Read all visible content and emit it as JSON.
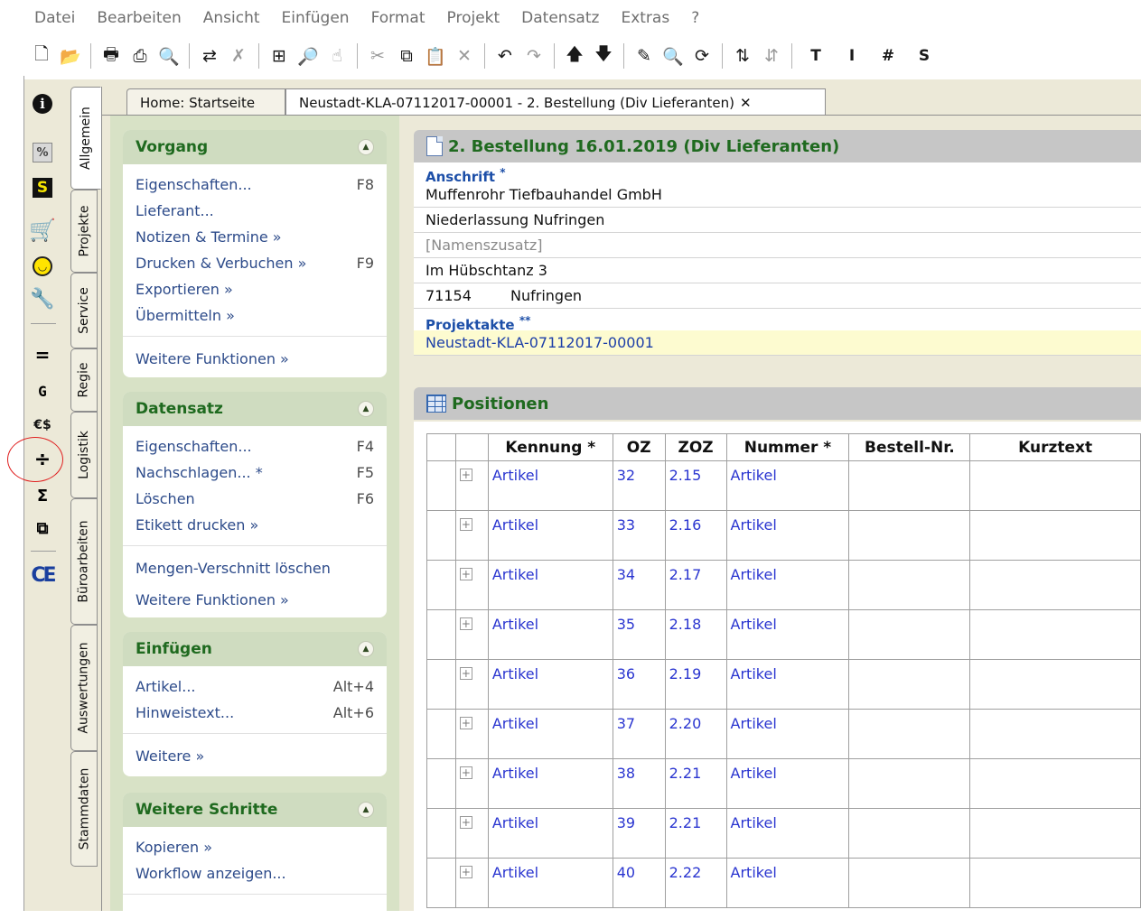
{
  "menu": [
    "Datei",
    "Bearbeiten",
    "Ansicht",
    "Einfügen",
    "Format",
    "Projekt",
    "Datensatz",
    "Extras",
    "?"
  ],
  "toolbar_text": {
    "t": "T",
    "i": "I",
    "hash": "#",
    "s": "S"
  },
  "icon_strip": {
    "g_label": "G",
    "eq_label": "=",
    "euro_label": "€$",
    "div_label": "÷",
    "sum_label": "Σ",
    "ce_label": "CE",
    "s_label": "S",
    "pct_label": "%"
  },
  "vertical_tabs": [
    "Allgemein",
    "Projekte",
    "Service",
    "Regie",
    "Logistik",
    "Büroarbeiten",
    "Auswertungen",
    "Stammdaten"
  ],
  "doc_tabs": [
    "Home: Startseite",
    "Neustadt-KLA-07112017-00001 - 2. Bestellung (Div Lieferanten)"
  ],
  "doc_tab_close": "✕",
  "panel": {
    "vorgang": {
      "title": "Vorgang",
      "items": [
        {
          "label": "Eigenschaften...",
          "key": "F8"
        },
        {
          "label": "Lieferant...",
          "key": ""
        },
        {
          "label": "Notizen & Termine »",
          "key": ""
        },
        {
          "label": "Drucken & Verbuchen »",
          "key": "F9"
        },
        {
          "label": "Exportieren »",
          "key": ""
        },
        {
          "label": "Übermitteln »",
          "key": ""
        }
      ],
      "more": "Weitere Funktionen »"
    },
    "datensatz": {
      "title": "Datensatz",
      "items": [
        {
          "label": "Eigenschaften...",
          "key": "F4"
        },
        {
          "label": "Nachschlagen... *",
          "key": "F5"
        },
        {
          "label": "Löschen",
          "key": "F6"
        },
        {
          "label": "Etikett drucken »",
          "key": ""
        }
      ],
      "extra": "Mengen-Verschnitt löschen",
      "more": "Weitere Funktionen »"
    },
    "einfuegen": {
      "title": "Einfügen",
      "items": [
        {
          "label": "Artikel...",
          "key": "Alt+4"
        },
        {
          "label": "Hinweistext...",
          "key": "Alt+6"
        }
      ],
      "more": "Weitere »"
    },
    "weitere_schritte": {
      "title": "Weitere Schritte",
      "items": [
        {
          "label": "Kopieren »",
          "key": ""
        },
        {
          "label": "Workflow anzeigen...",
          "key": ""
        }
      ]
    }
  },
  "document": {
    "title": "2. Bestellung 16.01.2019 (Div Lieferanten)",
    "anschrift_label": "Anschrift",
    "anschrift_mark": "*",
    "address": {
      "line1": "Muffenrohr Tiefbauhandel GmbH",
      "line2": "Niederlassung Nufringen",
      "line3_placeholder": "[Namenszusatz]",
      "street": "Im Hübschtanz 3",
      "plz": "71154",
      "city": "Nufringen"
    },
    "projektakte_label": "Projektakte",
    "projektakte_mark": "**",
    "projektakte": "Neustadt-KLA-07112017-00001"
  },
  "positions": {
    "title": "Positionen",
    "columns": [
      "Kennung *",
      "OZ",
      "ZOZ",
      "Nummer *",
      "Bestell-Nr.",
      "Kurztext"
    ],
    "expand_symbol": "+",
    "rows": [
      {
        "kennung": "Artikel",
        "oz": "32",
        "zoz": "2.15",
        "nummer": "Artikel"
      },
      {
        "kennung": "Artikel",
        "oz": "33",
        "zoz": "2.16",
        "nummer": "Artikel"
      },
      {
        "kennung": "Artikel",
        "oz": "34",
        "zoz": "2.17",
        "nummer": "Artikel"
      },
      {
        "kennung": "Artikel",
        "oz": "35",
        "zoz": "2.18",
        "nummer": "Artikel"
      },
      {
        "kennung": "Artikel",
        "oz": "36",
        "zoz": "2.19",
        "nummer": "Artikel"
      },
      {
        "kennung": "Artikel",
        "oz": "37",
        "zoz": "2.20",
        "nummer": "Artikel"
      },
      {
        "kennung": "Artikel",
        "oz": "38",
        "zoz": "2.21",
        "nummer": "Artikel"
      },
      {
        "kennung": "Artikel",
        "oz": "39",
        "zoz": "2.21",
        "nummer": "Artikel"
      },
      {
        "kennung": "Artikel",
        "oz": "40",
        "zoz": "2.22",
        "nummer": "Artikel"
      }
    ]
  },
  "colors": {
    "panel_bg": "#d8e2c6",
    "panel_title": "#1f6a1f",
    "link_blue": "#2a35d0",
    "highlight": "#fdfbd0",
    "mark_red": "#e02020"
  }
}
